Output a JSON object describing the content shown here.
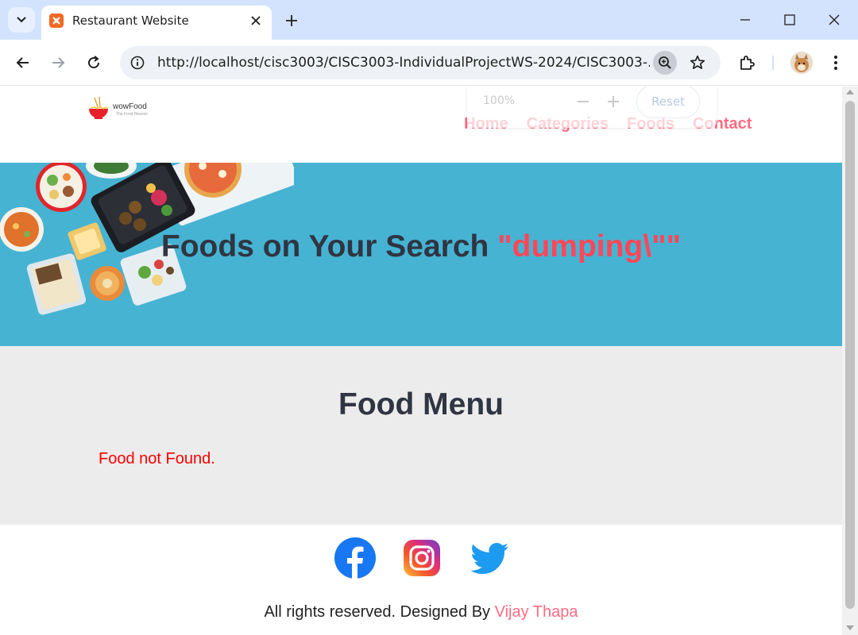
{
  "browser": {
    "tab_title": "Restaurant Website",
    "url": "http://localhost/cisc3003/CISC3003-IndividualProjectWS-2024/CISC3003-...",
    "zoom_popup": {
      "level": "100%",
      "reset_label": "Reset"
    },
    "icons": [
      "tab-list-icon",
      "xampp-favicon-icon",
      "close-icon",
      "plus-icon",
      "minimize-icon",
      "maximize-icon",
      "close-window-icon",
      "back-icon",
      "forward-icon",
      "reload-icon",
      "site-info-icon",
      "zoom-icon",
      "star-icon",
      "extensions-icon",
      "profile-avatar",
      "more-menu-icon"
    ]
  },
  "site": {
    "logo": {
      "name": "wowFood",
      "tagline": "The Food Heaven"
    },
    "nav": {
      "home": "Home",
      "categories": "Categories",
      "foods": "Foods",
      "contact": "Contact"
    },
    "hero": {
      "title_prefix": "Foods on Your Search ",
      "query": "\"dumping\\\"\""
    },
    "food_menu": {
      "heading": "Food Menu",
      "message": "Food not Found."
    },
    "footer": {
      "social": [
        "facebook-icon",
        "instagram-icon",
        "twitter-icon"
      ],
      "copyright": "All rights reserved. Designed By ",
      "designer": "Vijay Thapa"
    }
  },
  "colors": {
    "accent": "#ff6b81",
    "hero_bg": "#46b3d3",
    "query": "#ff4757",
    "menu_bg": "#ececec",
    "error": "#ff0000",
    "heading": "#2f3542"
  }
}
